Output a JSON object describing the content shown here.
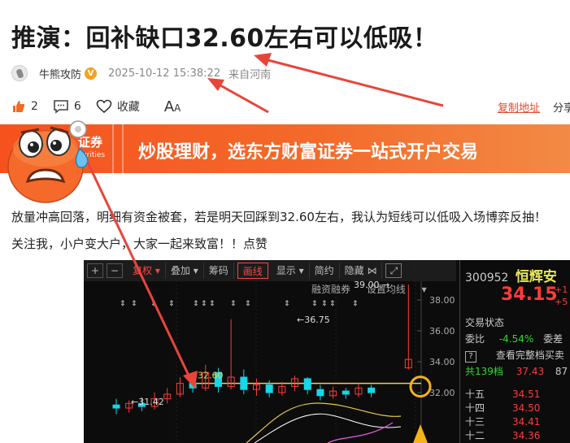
{
  "article": {
    "title": "推演：回补缺口32.60左右可以低吸！",
    "author": "牛熊攻防",
    "verified_badge": "V",
    "datetime": "2025-10-12 15:38:22",
    "location": "来自河南",
    "likes": "2",
    "comments": "6",
    "favorite_label": "收藏",
    "font_big": "A",
    "font_small": "A",
    "copy_link": "复制地址",
    "share_label": "分享",
    "banner_logo": "证券",
    "banner_logo_sub": "curities",
    "banner_text": "炒股理财，选东方财富证券一站式开户交易",
    "paragraph1": "放量冲高回落，明细有资金被套，若是明天回踩到32.60左右，我认为短线可以低吸入场博弈反抽！",
    "paragraph2": "关注我，小户变大户，大家一起来致富！！点赞"
  },
  "chart_ui": {
    "toolbar": [
      "+",
      "−",
      "复权",
      "叠加",
      "筹码",
      "画线",
      "显示",
      "简约",
      "隐藏"
    ],
    "sub_labels": [
      "融资融券",
      "设置均线"
    ],
    "stock_code": "300952",
    "stock_name": "恒辉安",
    "price": "34.15",
    "change1": "+1",
    "change2": "+5",
    "trade_status": "交易状态",
    "weibi_label": "委比",
    "weibi_value": "-4.54%",
    "weicha_label": "委差",
    "full_queue": "查看完整档买卖",
    "queue_label": "共139档",
    "queue_price": "37.43",
    "queue_vol": "87",
    "orderbook": [
      {
        "label": "十五",
        "price": "34.51"
      },
      {
        "label": "十四",
        "price": "34.50"
      },
      {
        "label": "十三",
        "price": "34.41"
      },
      {
        "label": "十二",
        "price": "34.36"
      }
    ]
  },
  "chart_data": {
    "type": "candlestick",
    "y_ticks": [
      "38.00",
      "36.00",
      "34.00",
      "32.00"
    ],
    "annotations": [
      "39.00",
      "36.75",
      "32.60",
      "31.42"
    ],
    "support_line": 32.6,
    "candles": [
      {
        "o": 31.2,
        "c": 31.0,
        "h": 31.6,
        "l": 30.6
      },
      {
        "o": 31.0,
        "c": 31.3,
        "h": 31.5,
        "l": 30.7
      },
      {
        "o": 31.3,
        "c": 31.1,
        "h": 31.7,
        "l": 30.8
      },
      {
        "o": 31.1,
        "c": 31.6,
        "h": 32.0,
        "l": 30.9
      },
      {
        "o": 31.6,
        "c": 31.9,
        "h": 32.3,
        "l": 31.3
      },
      {
        "o": 31.9,
        "c": 32.6,
        "h": 33.0,
        "l": 31.7
      },
      {
        "o": 32.6,
        "c": 32.3,
        "h": 33.2,
        "l": 32.0
      },
      {
        "o": 32.3,
        "c": 33.3,
        "h": 33.8,
        "l": 32.1
      },
      {
        "o": 33.3,
        "c": 32.4,
        "h": 33.6,
        "l": 32.0
      },
      {
        "o": 32.4,
        "c": 33.0,
        "h": 36.75,
        "l": 32.2
      },
      {
        "o": 33.0,
        "c": 32.2,
        "h": 33.5,
        "l": 31.9
      },
      {
        "o": 32.2,
        "c": 32.5,
        "h": 32.9,
        "l": 31.8
      },
      {
        "o": 32.5,
        "c": 32.0,
        "h": 32.8,
        "l": 31.7
      },
      {
        "o": 32.0,
        "c": 32.4,
        "h": 32.7,
        "l": 31.8
      },
      {
        "o": 32.4,
        "c": 32.9,
        "h": 33.1,
        "l": 32.1
      },
      {
        "o": 32.9,
        "c": 32.2,
        "h": 33.0,
        "l": 31.9
      },
      {
        "o": 32.2,
        "c": 31.8,
        "h": 32.5,
        "l": 31.5
      },
      {
        "o": 31.8,
        "c": 32.1,
        "h": 32.4,
        "l": 31.6
      },
      {
        "o": 32.1,
        "c": 31.9,
        "h": 32.3,
        "l": 31.6
      },
      {
        "o": 31.9,
        "c": 32.3,
        "h": 32.6,
        "l": 31.7
      },
      {
        "o": 32.3,
        "c": 32.0,
        "h": 32.5,
        "l": 31.7
      },
      {
        "o": 33.6,
        "c": 34.15,
        "h": 39.0,
        "l": 33.5
      }
    ]
  },
  "colors": {
    "up": "#ff3b3b",
    "down": "#12d8e8",
    "accent": "#f5521e",
    "arrow": "#e8453a"
  }
}
